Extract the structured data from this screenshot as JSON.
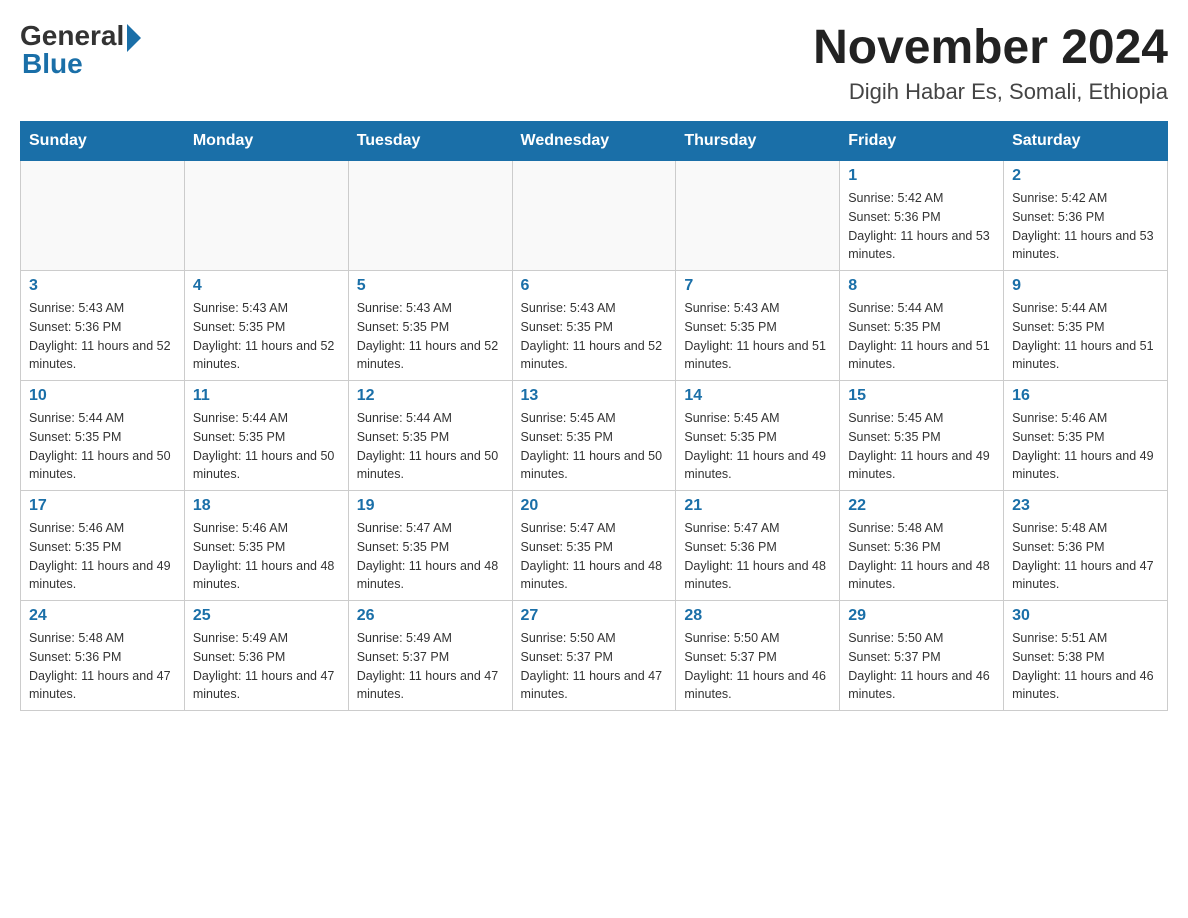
{
  "header": {
    "logo_general": "General",
    "logo_blue": "Blue",
    "month_title": "November 2024",
    "location": "Digih Habar Es, Somali, Ethiopia"
  },
  "weekdays": [
    "Sunday",
    "Monday",
    "Tuesday",
    "Wednesday",
    "Thursday",
    "Friday",
    "Saturday"
  ],
  "weeks": [
    [
      {
        "day": "",
        "info": ""
      },
      {
        "day": "",
        "info": ""
      },
      {
        "day": "",
        "info": ""
      },
      {
        "day": "",
        "info": ""
      },
      {
        "day": "",
        "info": ""
      },
      {
        "day": "1",
        "info": "Sunrise: 5:42 AM\nSunset: 5:36 PM\nDaylight: 11 hours and 53 minutes."
      },
      {
        "day": "2",
        "info": "Sunrise: 5:42 AM\nSunset: 5:36 PM\nDaylight: 11 hours and 53 minutes."
      }
    ],
    [
      {
        "day": "3",
        "info": "Sunrise: 5:43 AM\nSunset: 5:36 PM\nDaylight: 11 hours and 52 minutes."
      },
      {
        "day": "4",
        "info": "Sunrise: 5:43 AM\nSunset: 5:35 PM\nDaylight: 11 hours and 52 minutes."
      },
      {
        "day": "5",
        "info": "Sunrise: 5:43 AM\nSunset: 5:35 PM\nDaylight: 11 hours and 52 minutes."
      },
      {
        "day": "6",
        "info": "Sunrise: 5:43 AM\nSunset: 5:35 PM\nDaylight: 11 hours and 52 minutes."
      },
      {
        "day": "7",
        "info": "Sunrise: 5:43 AM\nSunset: 5:35 PM\nDaylight: 11 hours and 51 minutes."
      },
      {
        "day": "8",
        "info": "Sunrise: 5:44 AM\nSunset: 5:35 PM\nDaylight: 11 hours and 51 minutes."
      },
      {
        "day": "9",
        "info": "Sunrise: 5:44 AM\nSunset: 5:35 PM\nDaylight: 11 hours and 51 minutes."
      }
    ],
    [
      {
        "day": "10",
        "info": "Sunrise: 5:44 AM\nSunset: 5:35 PM\nDaylight: 11 hours and 50 minutes."
      },
      {
        "day": "11",
        "info": "Sunrise: 5:44 AM\nSunset: 5:35 PM\nDaylight: 11 hours and 50 minutes."
      },
      {
        "day": "12",
        "info": "Sunrise: 5:44 AM\nSunset: 5:35 PM\nDaylight: 11 hours and 50 minutes."
      },
      {
        "day": "13",
        "info": "Sunrise: 5:45 AM\nSunset: 5:35 PM\nDaylight: 11 hours and 50 minutes."
      },
      {
        "day": "14",
        "info": "Sunrise: 5:45 AM\nSunset: 5:35 PM\nDaylight: 11 hours and 49 minutes."
      },
      {
        "day": "15",
        "info": "Sunrise: 5:45 AM\nSunset: 5:35 PM\nDaylight: 11 hours and 49 minutes."
      },
      {
        "day": "16",
        "info": "Sunrise: 5:46 AM\nSunset: 5:35 PM\nDaylight: 11 hours and 49 minutes."
      }
    ],
    [
      {
        "day": "17",
        "info": "Sunrise: 5:46 AM\nSunset: 5:35 PM\nDaylight: 11 hours and 49 minutes."
      },
      {
        "day": "18",
        "info": "Sunrise: 5:46 AM\nSunset: 5:35 PM\nDaylight: 11 hours and 48 minutes."
      },
      {
        "day": "19",
        "info": "Sunrise: 5:47 AM\nSunset: 5:35 PM\nDaylight: 11 hours and 48 minutes."
      },
      {
        "day": "20",
        "info": "Sunrise: 5:47 AM\nSunset: 5:35 PM\nDaylight: 11 hours and 48 minutes."
      },
      {
        "day": "21",
        "info": "Sunrise: 5:47 AM\nSunset: 5:36 PM\nDaylight: 11 hours and 48 minutes."
      },
      {
        "day": "22",
        "info": "Sunrise: 5:48 AM\nSunset: 5:36 PM\nDaylight: 11 hours and 48 minutes."
      },
      {
        "day": "23",
        "info": "Sunrise: 5:48 AM\nSunset: 5:36 PM\nDaylight: 11 hours and 47 minutes."
      }
    ],
    [
      {
        "day": "24",
        "info": "Sunrise: 5:48 AM\nSunset: 5:36 PM\nDaylight: 11 hours and 47 minutes."
      },
      {
        "day": "25",
        "info": "Sunrise: 5:49 AM\nSunset: 5:36 PM\nDaylight: 11 hours and 47 minutes."
      },
      {
        "day": "26",
        "info": "Sunrise: 5:49 AM\nSunset: 5:37 PM\nDaylight: 11 hours and 47 minutes."
      },
      {
        "day": "27",
        "info": "Sunrise: 5:50 AM\nSunset: 5:37 PM\nDaylight: 11 hours and 47 minutes."
      },
      {
        "day": "28",
        "info": "Sunrise: 5:50 AM\nSunset: 5:37 PM\nDaylight: 11 hours and 46 minutes."
      },
      {
        "day": "29",
        "info": "Sunrise: 5:50 AM\nSunset: 5:37 PM\nDaylight: 11 hours and 46 minutes."
      },
      {
        "day": "30",
        "info": "Sunrise: 5:51 AM\nSunset: 5:38 PM\nDaylight: 11 hours and 46 minutes."
      }
    ]
  ]
}
